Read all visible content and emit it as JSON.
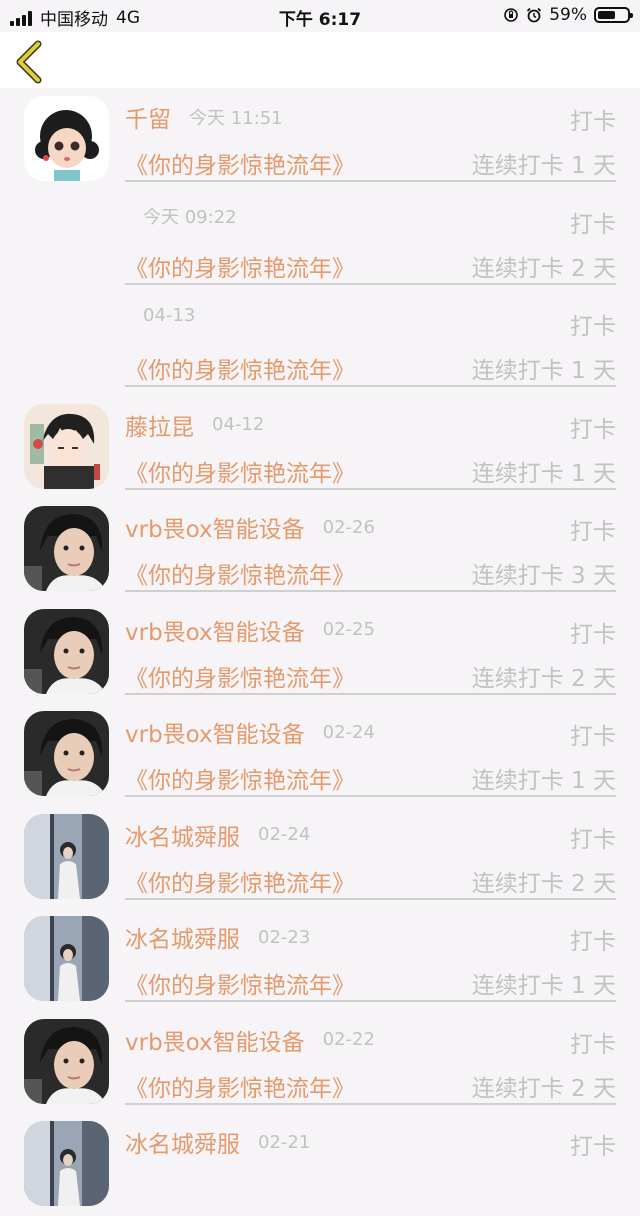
{
  "status_bar": {
    "carrier": "中国移动",
    "network": "4G",
    "time": "下午 6:17",
    "battery": "59%",
    "battery_level": 0.59
  },
  "nav": {
    "back_icon": "chevron-left-icon",
    "accent": "#e0cf3a"
  },
  "colors": {
    "name": "#e59a6c",
    "muted": "#c2c2c2",
    "background": "#f6f4f7"
  },
  "records": [
    {
      "avatar": "girl-cartoon",
      "name": "千留",
      "time": "今天 11:51",
      "action": "打卡",
      "book": "《你的身影惊艳流年》",
      "streak": "连续打卡 1 天"
    },
    {
      "avatar": "",
      "name": "",
      "time": "今天 09:22",
      "action": "打卡",
      "book": "《你的身影惊艳流年》",
      "streak": "连续打卡 2 天"
    },
    {
      "avatar": "",
      "name": "",
      "time": "04-13",
      "action": "打卡",
      "book": "《你的身影惊艳流年》",
      "streak": "连续打卡 1 天"
    },
    {
      "avatar": "boy-anime",
      "name": "藤拉昆",
      "time": "04-12",
      "action": "打卡",
      "book": "《你的身影惊艳流年》",
      "streak": "连续打卡 1 天"
    },
    {
      "avatar": "child-photo",
      "name": "vrb畏ox智能设备",
      "time": "02-26",
      "action": "打卡",
      "book": "《你的身影惊艳流年》",
      "streak": "连续打卡 3 天"
    },
    {
      "avatar": "child-photo",
      "name": "vrb畏ox智能设备",
      "time": "02-25",
      "action": "打卡",
      "book": "《你的身影惊艳流年》",
      "streak": "连续打卡 2 天"
    },
    {
      "avatar": "child-photo",
      "name": "vrb畏ox智能设备",
      "time": "02-24",
      "action": "打卡",
      "book": "《你的身影惊艳流年》",
      "streak": "连续打卡 1 天"
    },
    {
      "avatar": "window-photo",
      "name": "冰名城舜服",
      "time": "02-24",
      "action": "打卡",
      "book": "《你的身影惊艳流年》",
      "streak": "连续打卡 2 天"
    },
    {
      "avatar": "window-photo",
      "name": "冰名城舜服",
      "time": "02-23",
      "action": "打卡",
      "book": "《你的身影惊艳流年》",
      "streak": "连续打卡 1 天"
    },
    {
      "avatar": "child-photo",
      "name": "vrb畏ox智能设备",
      "time": "02-22",
      "action": "打卡",
      "book": "《你的身影惊艳流年》",
      "streak": "连续打卡 2 天"
    },
    {
      "avatar": "window-photo",
      "name": "冰名城舜服",
      "time": "02-21",
      "action": "打卡",
      "book": "",
      "streak": ""
    }
  ]
}
